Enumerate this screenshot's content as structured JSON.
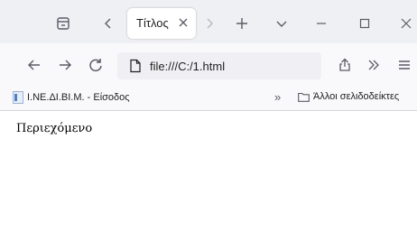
{
  "tab": {
    "title": "Τίτλος"
  },
  "address": {
    "url": "file:///C:/1.html"
  },
  "bookmarks": {
    "item1": "Ι.ΝΕ.ΔΙ.ΒΙ.Μ. - Είσοδος",
    "other": "Άλλοι σελιδοδείκτες"
  },
  "page": {
    "content": "Περιεχόμενο"
  },
  "icons": {
    "tab_manager": "tab-manager-icon",
    "scroll_left": "chevron-left-icon",
    "close": "close-icon",
    "scroll_right": "chevron-right-icon",
    "new_tab": "plus-icon",
    "list_tabs": "chevron-down-icon",
    "minimize": "minimize-icon",
    "maximize": "maximize-icon",
    "back": "back-arrow-icon",
    "forward": "forward-arrow-icon",
    "reload": "reload-icon",
    "page": "page-icon",
    "star": "star-icon",
    "share": "share-icon",
    "overflow": "double-chevron-icon",
    "menu": "hamburger-icon",
    "folder": "folder-icon"
  },
  "colors": {
    "tabbar_bg": "#eff0f4",
    "toolbar_bg": "#f9f9fb",
    "urlbar_bg": "#f0f0f4"
  }
}
